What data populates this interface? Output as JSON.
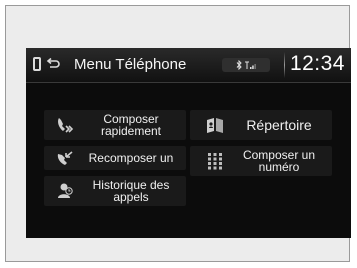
{
  "header": {
    "title": "Menu Téléphone",
    "clock": "12:34",
    "status_icons": [
      "bluetooth-icon",
      "signal-icon"
    ]
  },
  "buttons": {
    "speed_dial": "Composer rapidement",
    "redial": "Recomposer un",
    "call_history": "Historique des appels",
    "phonebook": "Répertoire",
    "dial": "Composer un numéro"
  },
  "icons": {
    "speed_dial": "speed-dial-icon",
    "redial": "redial-icon",
    "call_history": "call-history-icon",
    "phonebook": "phonebook-icon",
    "dial": "keypad-icon"
  }
}
